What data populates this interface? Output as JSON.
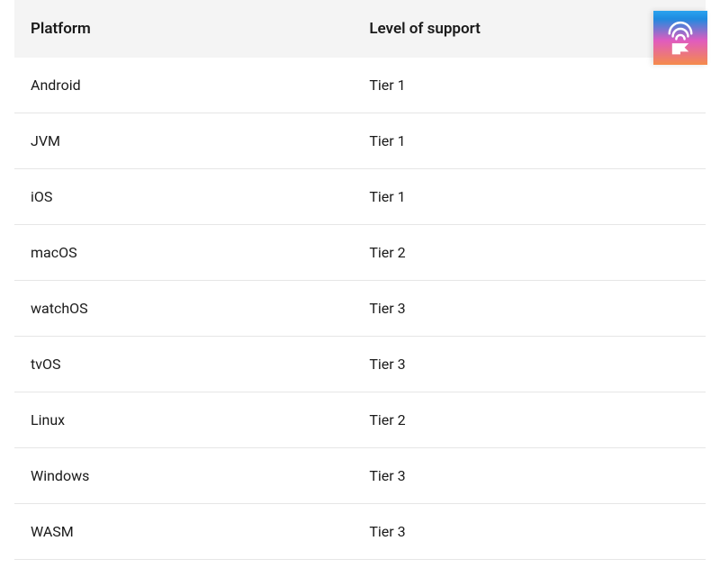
{
  "table": {
    "headers": {
      "platform": "Platform",
      "support": "Level of support"
    },
    "rows": [
      {
        "platform": "Android",
        "support": "Tier 1"
      },
      {
        "platform": "JVM",
        "support": "Tier 1"
      },
      {
        "platform": "iOS",
        "support": "Tier 1"
      },
      {
        "platform": "macOS",
        "support": "Tier 2"
      },
      {
        "platform": "watchOS",
        "support": "Tier 3"
      },
      {
        "platform": "tvOS",
        "support": "Tier 3"
      },
      {
        "platform": "Linux",
        "support": "Tier 2"
      },
      {
        "platform": "Windows",
        "support": "Tier 3"
      },
      {
        "platform": "WASM",
        "support": "Tier 3"
      }
    ]
  },
  "logo": {
    "name": "kotlin-conf-icon"
  }
}
